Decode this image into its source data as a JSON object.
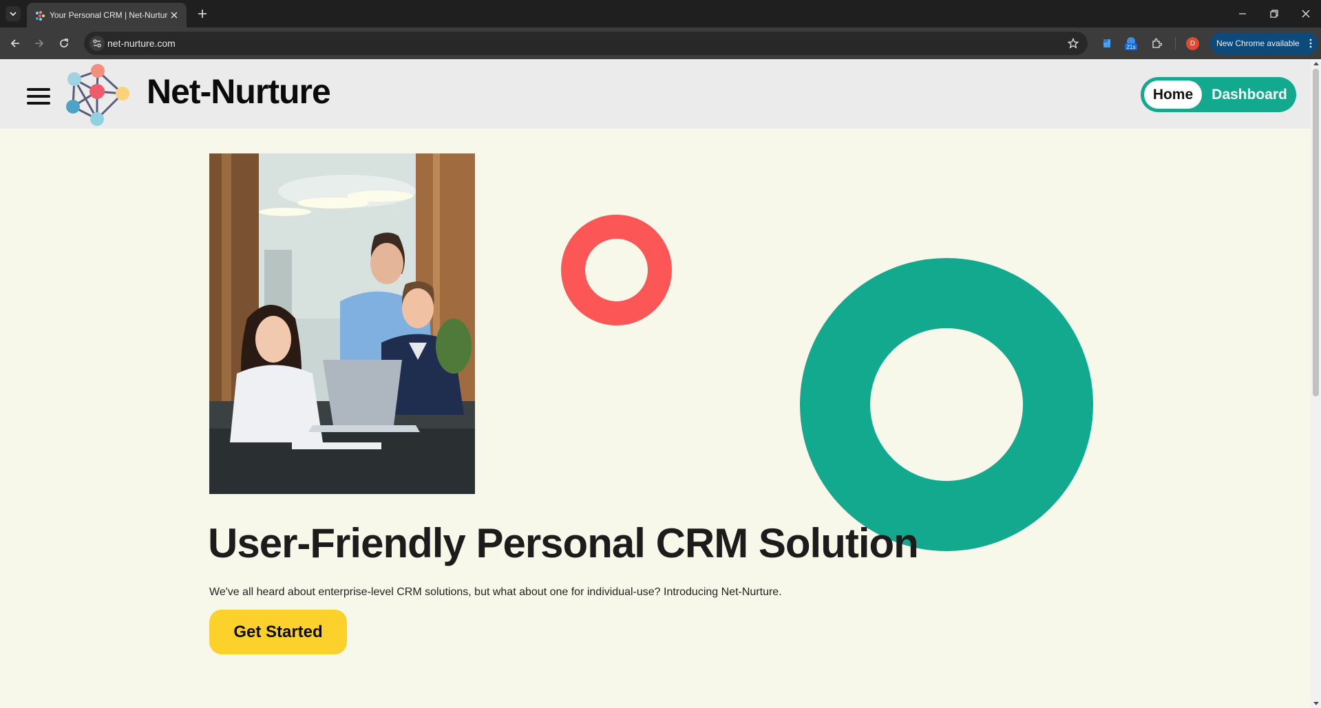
{
  "browser": {
    "tab_title": "Your Personal CRM | Net-Nurture",
    "url": "net-nurture.com",
    "extension_badge": "21s",
    "profile_initial": "D",
    "update_label": "New Chrome available"
  },
  "header": {
    "brand": "Net-Nurture",
    "nav": {
      "home": "Home",
      "dashboard": "Dashboard"
    }
  },
  "hero": {
    "title": "User-Friendly Personal CRM Solution",
    "subtitle": "We've all heard about enterprise-level CRM solutions, but what about one for individual-use? Introducing Net-Nurture.",
    "cta": "Get Started"
  },
  "colors": {
    "accent_green": "#13a98f",
    "accent_red": "#fd5656",
    "cta_yellow": "#fdd12b",
    "page_bg": "#f8f8ea",
    "header_bg": "#ebebeb"
  },
  "icons": [
    "tab-search-icon",
    "favicon-icon",
    "close-icon",
    "plus-icon",
    "minimize-icon",
    "restore-icon",
    "back-icon",
    "forward-icon",
    "reload-icon",
    "site-info-icon",
    "star-icon",
    "extension-icon",
    "puzzle-icon",
    "more-vert-icon",
    "hamburger-icon",
    "network-logo-icon"
  ]
}
